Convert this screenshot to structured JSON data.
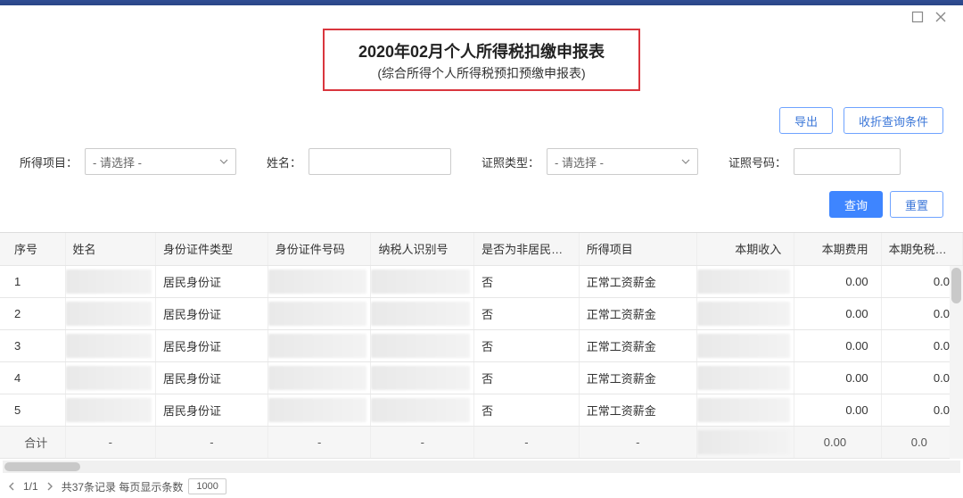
{
  "window": {
    "maximize_icon": "maximize",
    "close_icon": "close"
  },
  "title": {
    "main": "2020年02月个人所得税扣缴申报表",
    "sub": "(综合所得个人所得税预扣预缴申报表)"
  },
  "actions": {
    "export_label": "导出",
    "toggle_filters_label": "收折查询条件"
  },
  "filters": {
    "income_item_label": "所得项目：",
    "income_item_placeholder": "- 请选择 -",
    "name_label": "姓名：",
    "id_type_label": "证照类型：",
    "id_type_placeholder": "- 请选择 -",
    "id_no_label": "证照号码：",
    "query_label": "查询",
    "reset_label": "重置"
  },
  "table": {
    "cols": [
      "序号",
      "姓名",
      "身份证件类型",
      "身份证件号码",
      "纳税人识别号",
      "是否为非居民个人",
      "所得项目",
      "本期收入",
      "本期费用",
      "本期免税收入"
    ],
    "id_type_value": "居民身份证",
    "non_resident_value": "否",
    "income_item_value": "正常工资薪金",
    "rows": [
      {
        "idx": "1",
        "fee": "0.00",
        "exempt": "0.0"
      },
      {
        "idx": "2",
        "fee": "0.00",
        "exempt": "0.0"
      },
      {
        "idx": "3",
        "fee": "0.00",
        "exempt": "0.0"
      },
      {
        "idx": "4",
        "fee": "0.00",
        "exempt": "0.0"
      },
      {
        "idx": "5",
        "fee": "0.00",
        "exempt": "0.0"
      }
    ],
    "total": {
      "label": "合计",
      "dash": "-",
      "fee": "0.00",
      "exempt": "0.0"
    }
  },
  "pager": {
    "page": "1/1",
    "records_text": "共37条记录  每页显示条数",
    "page_size": "1000"
  }
}
